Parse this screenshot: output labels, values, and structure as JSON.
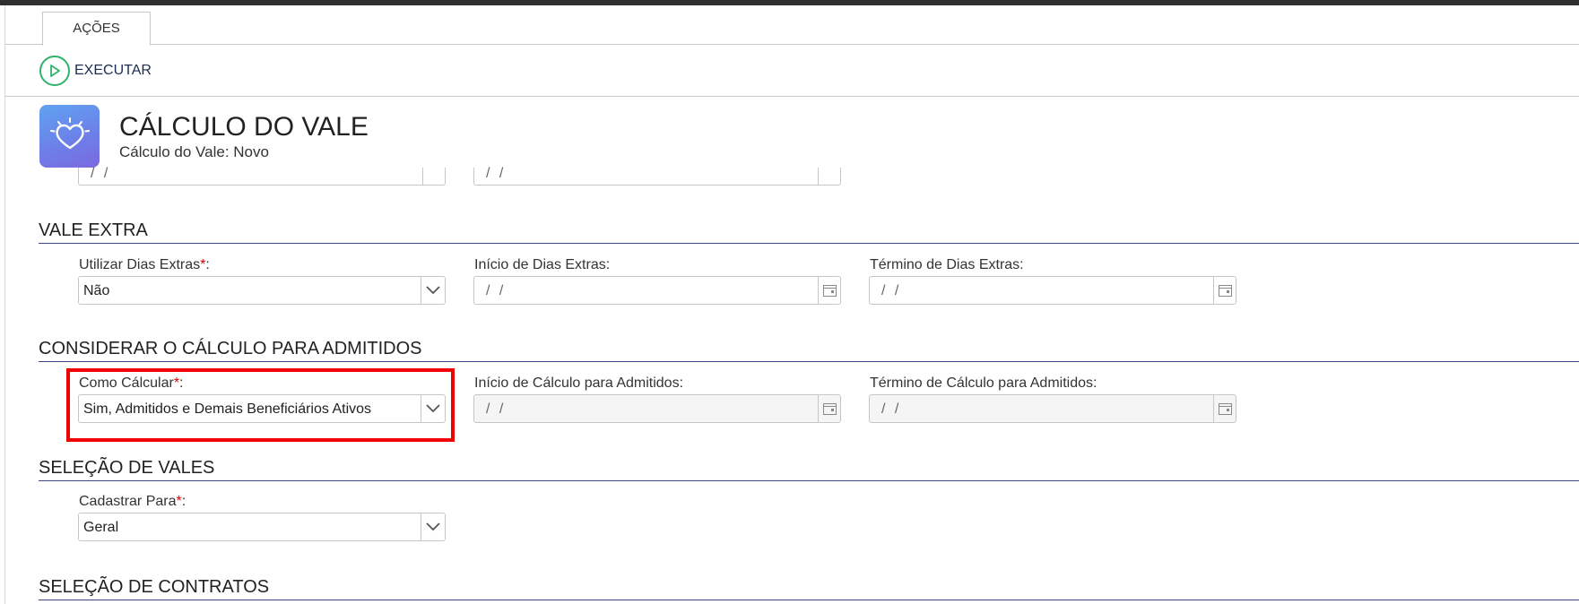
{
  "tabs": [
    {
      "label": "AÇÕES"
    }
  ],
  "toolbar": {
    "execute_label": "EXECUTAR"
  },
  "header": {
    "title": "CÁLCULO DO VALE",
    "subtitle": "Cálculo do Vale: Novo"
  },
  "partial_row": {
    "field1_value": "/ /",
    "field2_value": "/ /"
  },
  "sections": {
    "vale_extra": {
      "title": "VALE EXTRA",
      "utilizar_label": "Utilizar Dias Extras",
      "utilizar_value": "Não",
      "inicio_label": "Início de Dias Extras:",
      "inicio_value": "/ /",
      "termino_label": "Término de Dias Extras:",
      "termino_value": "/ /"
    },
    "admitidos": {
      "title": "CONSIDERAR O CÁLCULO PARA ADMITIDOS",
      "como_label": "Como Cálcular",
      "como_value": "Sim, Admitidos e Demais Beneficiários Ativos",
      "inicio_label": "Início de Cálculo para Admitidos:",
      "inicio_value": "/ /",
      "termino_label": "Término de Cálculo para Admitidos:",
      "termino_value": "/ /"
    },
    "selecao_vales": {
      "title": "SELEÇÃO DE VALES",
      "cadastrar_label": "Cadastrar Para",
      "cadastrar_value": "Geral"
    },
    "selecao_contratos": {
      "title": "SELEÇÃO DE CONTRATOS"
    }
  },
  "required_marker": "*",
  "label_suffix": ":",
  "colors": {
    "accent_green": "#2db36b",
    "section_line": "#3b4a86",
    "required": "#e00000",
    "highlight": "#f00000"
  }
}
